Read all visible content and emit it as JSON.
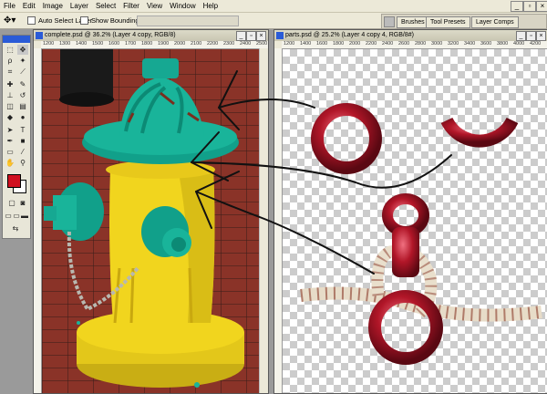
{
  "menu": [
    "File",
    "Edit",
    "Image",
    "Layer",
    "Select",
    "Filter",
    "View",
    "Window",
    "Help"
  ],
  "options": {
    "auto_select": "Auto Select Layer",
    "show_bounding": "Show Bounding Box"
  },
  "panel_well": [
    "Brushes",
    "Tool Presets",
    "Layer Comps"
  ],
  "doc_left": {
    "title": "complete.psd @ 36.2% (Layer 4 copy, RGB/8)",
    "ruler": [
      "1200",
      "1300",
      "1400",
      "1500",
      "1600",
      "1700",
      "1800",
      "1900",
      "2000",
      "2100",
      "2200",
      "2300",
      "2400",
      "2500"
    ]
  },
  "doc_right": {
    "title": "parts.psd @ 25.2% (Layer 4 copy 4, RGB/8#)",
    "ruler": [
      "1200",
      "1400",
      "1600",
      "1800",
      "2000",
      "2200",
      "2400",
      "2600",
      "2800",
      "3000",
      "3200",
      "3400",
      "3600",
      "3800",
      "4000",
      "4200"
    ]
  },
  "colors": {
    "foreground": "#d01020",
    "background": "#ffffff",
    "hydrant_yellow": "#f1d51e",
    "hydrant_teal": "#19b49a",
    "ring_red": "#b11628"
  },
  "icons": [
    "move-icon",
    "marquee-icon",
    "lasso-icon",
    "magic-wand-icon",
    "crop-icon",
    "slice-icon",
    "heal-icon",
    "brush-icon",
    "stamp-icon",
    "history-brush-icon",
    "eraser-icon",
    "gradient-icon",
    "blur-icon",
    "dodge-icon",
    "path-select-icon",
    "type-icon",
    "pen-icon",
    "shape-icon",
    "notes-icon",
    "eyedropper-icon",
    "hand-icon",
    "zoom-icon"
  ]
}
